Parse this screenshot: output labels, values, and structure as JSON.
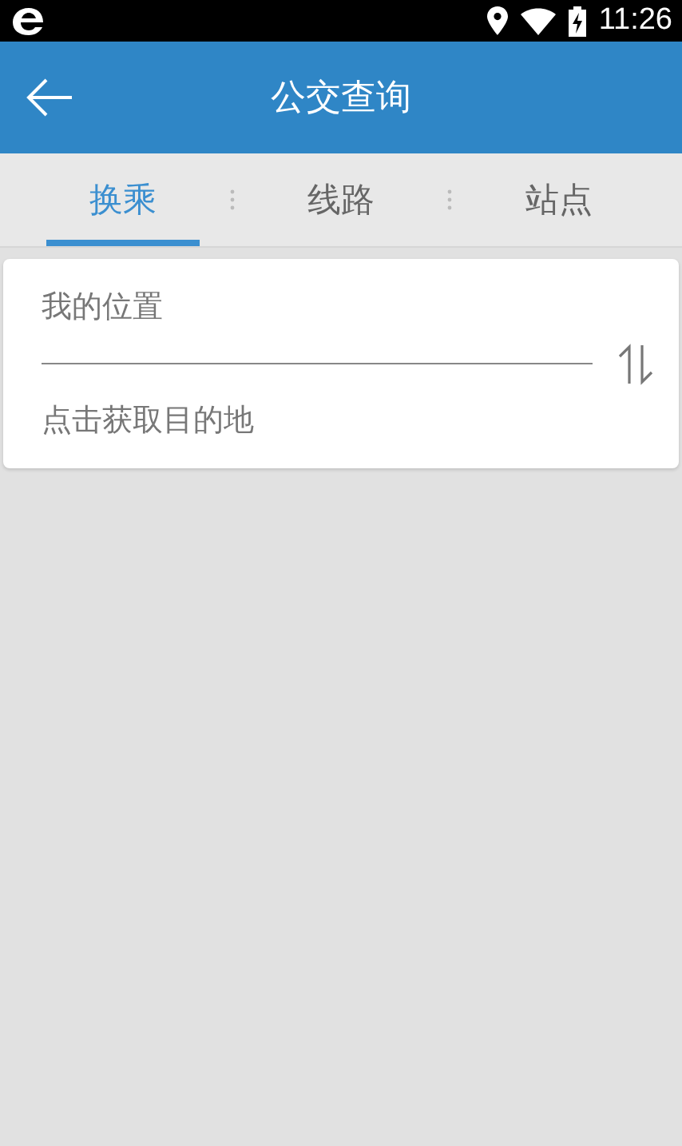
{
  "status_bar": {
    "time": "11:26"
  },
  "app_bar": {
    "title": "公交查询"
  },
  "tabs": [
    {
      "label": "换乘",
      "selected": true
    },
    {
      "label": "线路",
      "selected": false
    },
    {
      "label": "站点",
      "selected": false
    }
  ],
  "route_form": {
    "origin": {
      "value": "我的位置"
    },
    "destination": {
      "placeholder": "点击获取目的地"
    }
  }
}
